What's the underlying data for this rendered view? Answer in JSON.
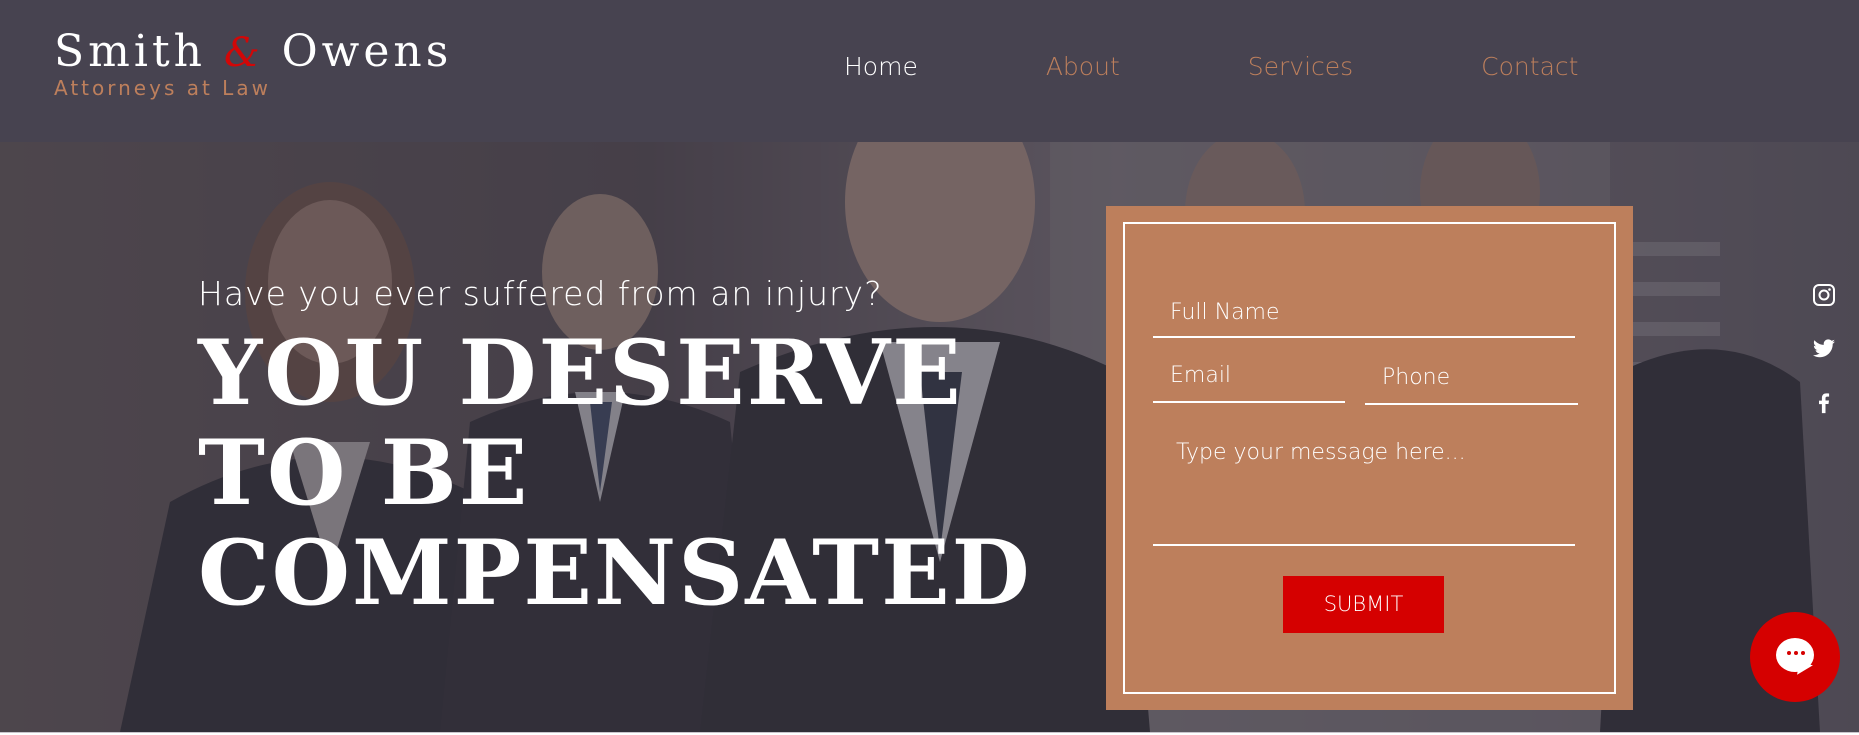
{
  "brand": {
    "name_part1": "Smith",
    "ampersand": "&",
    "name_part2": "Owens",
    "tagline": "Attorneys at Law"
  },
  "nav": {
    "items": [
      {
        "label": "Home",
        "active": true
      },
      {
        "label": "About",
        "active": false
      },
      {
        "label": "Services",
        "active": false
      },
      {
        "label": "Contact",
        "active": false
      }
    ]
  },
  "hero": {
    "question": "Have you ever suffered from an injury?",
    "headline_lines": [
      "YOU DESERVE",
      "TO BE",
      "COMPENSATED"
    ]
  },
  "form": {
    "full_name_placeholder": "Full Name",
    "email_placeholder": "Email",
    "phone_placeholder": "Phone",
    "message_placeholder": "Type your message here...",
    "submit_label": "SUBMIT"
  },
  "social": {
    "icons": [
      "instagram-icon",
      "twitter-icon",
      "facebook-icon"
    ]
  },
  "chat": {
    "icon": "chat-icon"
  },
  "colors": {
    "header_bg": "#474350",
    "accent_copper": "#bd7f5c",
    "accent_red": "#d50000",
    "text_white": "#ffffff"
  }
}
